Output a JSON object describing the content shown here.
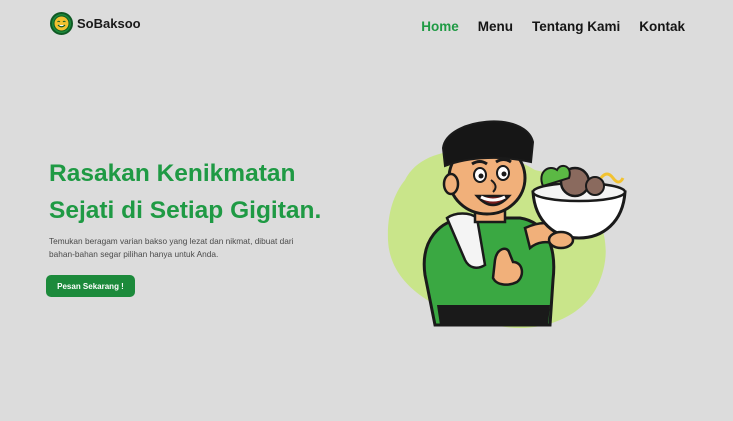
{
  "brand": {
    "name": "SoBaksoo",
    "logo_icon": "smiling-face-logo-icon"
  },
  "nav": {
    "items": [
      {
        "label": "Home",
        "active": true
      },
      {
        "label": "Menu",
        "active": false
      },
      {
        "label": "Tentang Kami",
        "active": false
      },
      {
        "label": "Kontak",
        "active": false
      }
    ]
  },
  "hero": {
    "title_line1": "Rasakan Kenikmatan",
    "title_line2": "Sejati di Setiap Gigitan.",
    "description_line1": "Temukan beragam varian bakso yang lezat dan nikmat, dibuat dari",
    "description_line2": "bahan-bahan segar pilihan hanya untuk Anda.",
    "cta_label": "Pesan Sekarang !"
  },
  "illustration": {
    "icon": "bakso-mascot-illustration"
  },
  "colors": {
    "accent": "#1f9a44",
    "button": "#1c8a3b",
    "background": "#dcdcdc",
    "blob": "#c9e58a"
  }
}
